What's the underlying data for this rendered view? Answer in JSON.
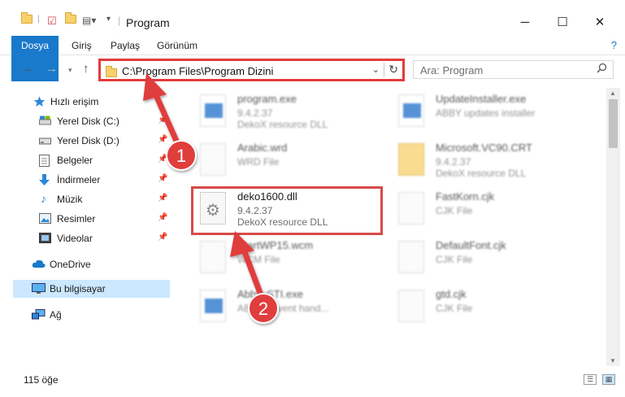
{
  "window": {
    "title": "Program",
    "minimize": "─",
    "maximize": "☐",
    "close": "✕"
  },
  "ribbon": {
    "tabs": [
      "Dosya",
      "Giriş",
      "Paylaş",
      "Görünüm"
    ],
    "help": "?"
  },
  "address": {
    "path": "C:\\Program Files\\Program Dizini",
    "dropdown": "⌄",
    "refresh": "↻"
  },
  "search": {
    "placeholder": "Ara: Program",
    "icon": "🔍"
  },
  "nav": {
    "items": [
      {
        "label": "Hızlı erişim",
        "icon": "star-icon"
      },
      {
        "label": "Yerel Disk (C:)",
        "icon": "drive-icon"
      },
      {
        "label": "Yerel Disk (D:)",
        "icon": "drive-icon"
      },
      {
        "label": "Belgeler",
        "icon": "documents-icon"
      },
      {
        "label": "İndirmeler",
        "icon": "download-icon"
      },
      {
        "label": "Müzik",
        "icon": "music-icon"
      },
      {
        "label": "Resimler",
        "icon": "pictures-icon"
      },
      {
        "label": "Videolar",
        "icon": "videos-icon"
      },
      {
        "label": "OneDrive",
        "icon": "cloud-icon"
      },
      {
        "label": "Bu bilgisayar",
        "icon": "computer-icon"
      },
      {
        "label": "Ağ",
        "icon": "network-icon"
      }
    ]
  },
  "files": [
    {
      "name": "program.exe",
      "line1": "9.4.2.37",
      "line2": "DekoX resource DLL",
      "type": "exe"
    },
    {
      "name": "UpdateInstaller.exe",
      "line1": "ABBY updates installer",
      "line2": "",
      "type": "exe"
    },
    {
      "name": "Arabic.wrd",
      "line1": "WRD File",
      "line2": "",
      "type": "blank"
    },
    {
      "name": "Microsoft.VC90.CRT",
      "line1": "9.4.2.37",
      "line2": "DekoX resource DLL",
      "type": "folder"
    },
    {
      "name": "deko1600.dll",
      "line1": "9.4.2.37",
      "line2": "DekoX resource DLL",
      "type": "cfg"
    },
    {
      "name": "FastKorn.cjk",
      "line1": "CJK File",
      "line2": "",
      "type": "blank"
    },
    {
      "name": "StartWP15.wcm",
      "line1": "WCM File",
      "line2": "",
      "type": "blank"
    },
    {
      "name": "DefaultFont.cjk",
      "line1": "CJK File",
      "line2": "",
      "type": "blank"
    },
    {
      "name": "AbbyySTI.exe",
      "line1": "ABBYY event hand...",
      "line2": "",
      "type": "exe"
    },
    {
      "name": "gtd.cjk",
      "line1": "CJK File",
      "line2": "",
      "type": "blank"
    }
  ],
  "status": {
    "count": "115 öğe"
  },
  "annotations": {
    "step1": "1",
    "step2": "2"
  },
  "colors": {
    "accent": "#1979ca",
    "highlight": "#d84a4a",
    "arrow": "#e03c3c"
  }
}
